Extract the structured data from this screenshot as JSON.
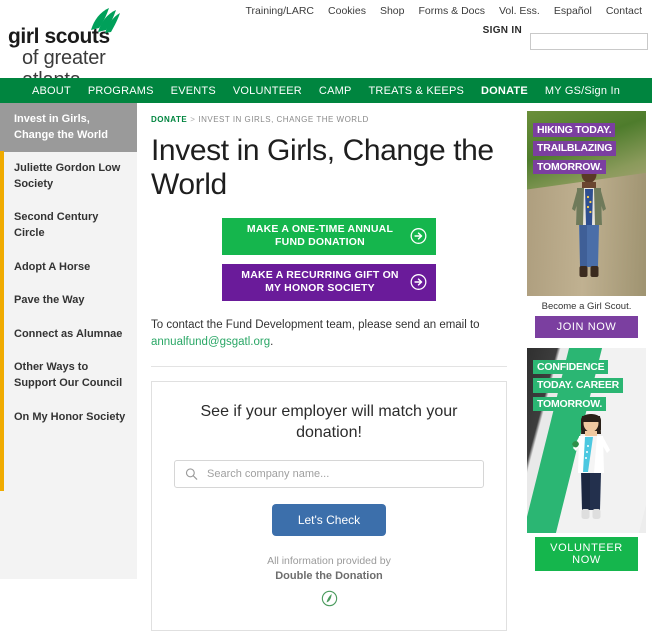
{
  "header": {
    "logo": {
      "line1": "girl scouts",
      "line2": "of greater atlanta",
      "trefoil_icon": "trefoil-icon"
    },
    "utility_links": [
      {
        "label": "Training/LARC"
      },
      {
        "label": "Cookies"
      },
      {
        "label": "Shop"
      },
      {
        "label": "Forms & Docs"
      },
      {
        "label": "Vol. Ess."
      },
      {
        "label": "Español"
      },
      {
        "label": "Contact"
      }
    ],
    "signin_label": "SIGN IN",
    "signin_input_value": "",
    "signin_input_placeholder": ""
  },
  "mainnav": {
    "items": [
      {
        "label": "ABOUT",
        "active": false
      },
      {
        "label": "PROGRAMS",
        "active": false
      },
      {
        "label": "EVENTS",
        "active": false
      },
      {
        "label": "VOLUNTEER",
        "active": false
      },
      {
        "label": "CAMP",
        "active": false
      },
      {
        "label": "TREATS & KEEPS",
        "active": false
      },
      {
        "label": "DONATE",
        "active": true
      },
      {
        "label": "MY GS/Sign In",
        "active": false
      }
    ],
    "background_color": "#00853f"
  },
  "sidebar": {
    "accent_color": "#f0ab00",
    "active_background": "#9a9a9a",
    "items": [
      {
        "label": "Invest in Girls, Change the World",
        "active": true
      },
      {
        "label": "Juliette Gordon Low Society",
        "active": false
      },
      {
        "label": "Second Century Circle",
        "active": false
      },
      {
        "label": "Adopt A Horse",
        "active": false
      },
      {
        "label": "Pave the Way",
        "active": false
      },
      {
        "label": "Connect as Alumnae",
        "active": false
      },
      {
        "label": "Other Ways to Support Our Council",
        "active": false
      },
      {
        "label": "On My Honor Society",
        "active": false
      }
    ]
  },
  "main": {
    "breadcrumb": {
      "root": "DONATE",
      "separator": ">",
      "current": "INVEST IN GIRLS, CHANGE THE WORLD"
    },
    "title": "Invest in Girls, Change the World",
    "cta_buttons": [
      {
        "label": "MAKE A ONE-TIME ANNUAL FUND DONATION",
        "color": "#15b64d",
        "icon": "circle-arrow-right-icon"
      },
      {
        "label": "MAKE A RECURRING GIFT ON MY HONOR SOCIETY",
        "color": "#6a1b9a",
        "icon": "circle-arrow-right-icon"
      }
    ],
    "contact": {
      "text_before": "To contact the Fund Development team, please send an email to ",
      "email": "annualfund@gsgatl.org",
      "text_after": ".",
      "email_color": "#2aa766"
    },
    "match_card": {
      "title": "See if your employer will match your donation!",
      "search_placeholder": "Search company name...",
      "search_value": "",
      "search_icon": "search-icon",
      "button_label": "Let's Check",
      "button_color": "#3c6fab",
      "provided_by_prefix": "All information provided by",
      "provided_by_name": "Double the Donation",
      "provided_by_logo": "double-the-donation-logo"
    }
  },
  "rail": {
    "ads": [
      {
        "banner_lines": [
          "HIKING TODAY.",
          "TRAILBLAZING",
          "TOMORROW."
        ],
        "banner_color": "#7b3fa0",
        "caption": "Become a Girl Scout.",
        "button_label": "JOIN NOW",
        "button_color": "#7b3fa0"
      },
      {
        "banner_lines": [
          "CONFIDENCE",
          "TODAY. CAREER",
          "TOMORROW."
        ],
        "banner_color": "#2bb673",
        "caption": "",
        "button_label": "VOLUNTEER NOW",
        "button_color": "#15b64d"
      }
    ]
  }
}
